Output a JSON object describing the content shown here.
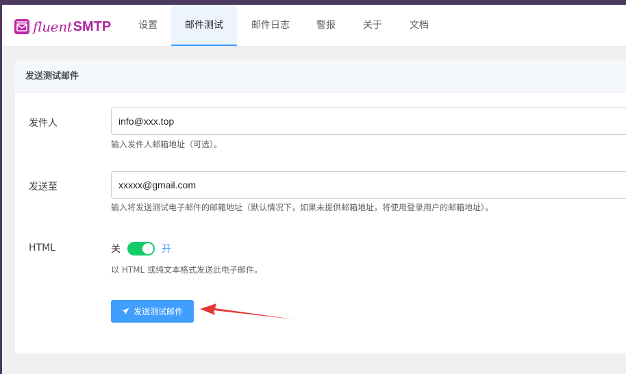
{
  "app": {
    "logo_fluent": "fluent",
    "logo_smtp": "SMTP",
    "brand_color": "#b0249d"
  },
  "nav": {
    "tabs": [
      {
        "label": "设置",
        "active": false
      },
      {
        "label": "邮件测试",
        "active": true
      },
      {
        "label": "邮件日志",
        "active": false
      },
      {
        "label": "警报",
        "active": false
      },
      {
        "label": "关于",
        "active": false
      },
      {
        "label": "文档",
        "active": false
      }
    ]
  },
  "card": {
    "title": "发送测试邮件"
  },
  "form": {
    "from": {
      "label": "发件人",
      "value": "info@xxx.top",
      "help": "输入发件人邮箱地址（可选）。"
    },
    "to": {
      "label": "发送至",
      "value": "xxxxx@gmail.com",
      "help": "输入将发送测试电子邮件的邮箱地址（默认情况下，如果未提供邮箱地址，将使用登录用户的邮箱地址）。"
    },
    "html": {
      "label": "HTML",
      "off_label": "关",
      "on_label": "开",
      "enabled": true,
      "help": "以 HTML 或纯文本格式发送此电子邮件。"
    },
    "submit_label": "发送测试邮件",
    "submit_icon": "paper-plane-icon"
  },
  "annotation": {
    "arrow_color": "#e53935"
  }
}
